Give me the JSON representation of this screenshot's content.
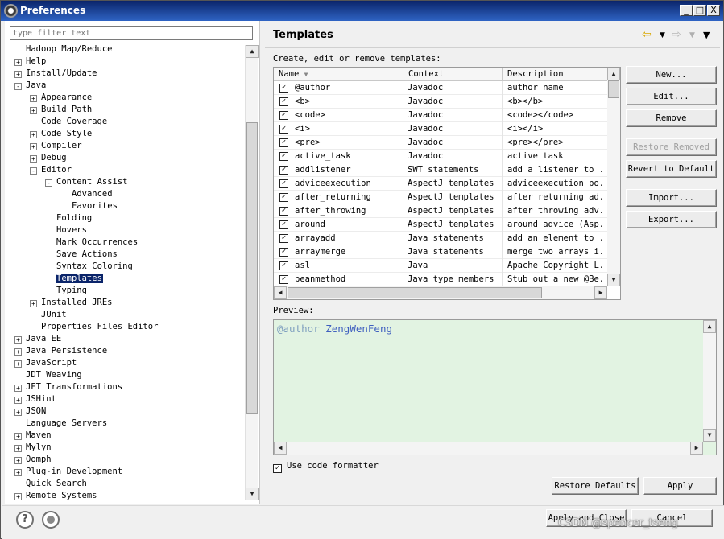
{
  "window": {
    "title": "Preferences",
    "controls": [
      "_",
      "□",
      "X"
    ]
  },
  "left": {
    "filter_placeholder": "type filter text",
    "tree": [
      {
        "label": "Hadoop Map/Reduce",
        "level": 0,
        "toggle": ""
      },
      {
        "label": "Help",
        "level": 0,
        "toggle": "+"
      },
      {
        "label": "Install/Update",
        "level": 0,
        "toggle": "+"
      },
      {
        "label": "Java",
        "level": 0,
        "toggle": "-"
      },
      {
        "label": "Appearance",
        "level": 1,
        "toggle": "+"
      },
      {
        "label": "Build Path",
        "level": 1,
        "toggle": "+"
      },
      {
        "label": "Code Coverage",
        "level": 1,
        "toggle": ""
      },
      {
        "label": "Code Style",
        "level": 1,
        "toggle": "+"
      },
      {
        "label": "Compiler",
        "level": 1,
        "toggle": "+"
      },
      {
        "label": "Debug",
        "level": 1,
        "toggle": "+"
      },
      {
        "label": "Editor",
        "level": 1,
        "toggle": "-"
      },
      {
        "label": "Content Assist",
        "level": 2,
        "toggle": "-"
      },
      {
        "label": "Advanced",
        "level": 3,
        "toggle": ""
      },
      {
        "label": "Favorites",
        "level": 3,
        "toggle": ""
      },
      {
        "label": "Folding",
        "level": 2,
        "toggle": ""
      },
      {
        "label": "Hovers",
        "level": 2,
        "toggle": ""
      },
      {
        "label": "Mark Occurrences",
        "level": 2,
        "toggle": ""
      },
      {
        "label": "Save Actions",
        "level": 2,
        "toggle": ""
      },
      {
        "label": "Syntax Coloring",
        "level": 2,
        "toggle": ""
      },
      {
        "label": "Templates",
        "level": 2,
        "toggle": "",
        "selected": true
      },
      {
        "label": "Typing",
        "level": 2,
        "toggle": ""
      },
      {
        "label": "Installed JREs",
        "level": 1,
        "toggle": "+"
      },
      {
        "label": "JUnit",
        "level": 1,
        "toggle": ""
      },
      {
        "label": "Properties Files Editor",
        "level": 1,
        "toggle": ""
      },
      {
        "label": "Java EE",
        "level": 0,
        "toggle": "+"
      },
      {
        "label": "Java Persistence",
        "level": 0,
        "toggle": "+"
      },
      {
        "label": "JavaScript",
        "level": 0,
        "toggle": "+"
      },
      {
        "label": "JDT Weaving",
        "level": 0,
        "toggle": ""
      },
      {
        "label": "JET Transformations",
        "level": 0,
        "toggle": "+"
      },
      {
        "label": "JSHint",
        "level": 0,
        "toggle": "+"
      },
      {
        "label": "JSON",
        "level": 0,
        "toggle": "+"
      },
      {
        "label": "Language Servers",
        "level": 0,
        "toggle": ""
      },
      {
        "label": "Maven",
        "level": 0,
        "toggle": "+"
      },
      {
        "label": "Mylyn",
        "level": 0,
        "toggle": "+"
      },
      {
        "label": "Oomph",
        "level": 0,
        "toggle": "+"
      },
      {
        "label": "Plug-in Development",
        "level": 0,
        "toggle": "+"
      },
      {
        "label": "Quick Search",
        "level": 0,
        "toggle": ""
      },
      {
        "label": "Remote Systems",
        "level": 0,
        "toggle": "+"
      }
    ]
  },
  "page": {
    "title": "Templates",
    "description": "Create, edit or remove templates:",
    "columns": [
      "Name",
      "Context",
      "Description"
    ],
    "rows": [
      {
        "name": "@author",
        "context": "Javadoc",
        "description": "author name",
        "checked": true
      },
      {
        "name": "<b>",
        "context": "Javadoc",
        "description": "<b></b>",
        "checked": true
      },
      {
        "name": "<code>",
        "context": "Javadoc",
        "description": "<code></code>",
        "checked": true
      },
      {
        "name": "<i>",
        "context": "Javadoc",
        "description": "<i></i>",
        "checked": true
      },
      {
        "name": "<pre>",
        "context": "Javadoc",
        "description": "<pre></pre>",
        "checked": true
      },
      {
        "name": "active_task",
        "context": "Javadoc",
        "description": "active task",
        "checked": true
      },
      {
        "name": "addlistener",
        "context": "SWT statements",
        "description": "add a listener to ...",
        "checked": true
      },
      {
        "name": "adviceexecution",
        "context": "AspectJ templates",
        "description": "adviceexecution po...",
        "checked": true
      },
      {
        "name": "after_returning",
        "context": "AspectJ templates",
        "description": "after returning ad...",
        "checked": true
      },
      {
        "name": "after_throwing",
        "context": "AspectJ templates",
        "description": "after throwing adv...",
        "checked": true
      },
      {
        "name": "around",
        "context": "AspectJ templates",
        "description": "around advice (Asp...",
        "checked": true
      },
      {
        "name": "arrayadd",
        "context": "Java statements",
        "description": "add an element to ...",
        "checked": true
      },
      {
        "name": "arraymerge",
        "context": "Java statements",
        "description": "merge two arrays i...",
        "checked": true
      },
      {
        "name": "asl",
        "context": "Java",
        "description": "Apache Copyright L...",
        "checked": true
      },
      {
        "name": "beanmethod",
        "context": "Java type members",
        "description": "Stub out a new @Be...",
        "checked": true
      }
    ],
    "buttons": {
      "new": "New...",
      "edit": "Edit...",
      "remove": "Remove",
      "restore_removed": "Restore Removed",
      "revert_default": "Revert to Default",
      "import": "Import...",
      "export": "Export..."
    },
    "preview_label": "Preview:",
    "preview": {
      "tag": "@author",
      "value": "ZengWenFeng"
    },
    "use_formatter": "Use code formatter",
    "restore_defaults": "Restore Defaults",
    "apply": "Apply"
  },
  "footer": {
    "help_glyph": "?",
    "apply_close": "Apply and Close",
    "cancel": "Cancel"
  },
  "watermark": "CSDN @spencer_tseng",
  "colors": {
    "selection": "#0a246a",
    "preview_bg": "#e2f3e2",
    "javadoc_tag": "#7f9fbf",
    "javadoc_text": "#3f5fbf"
  }
}
